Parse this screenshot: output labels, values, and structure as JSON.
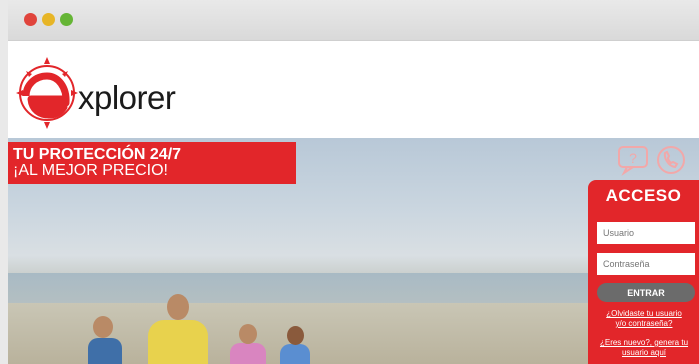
{
  "brand": {
    "logo_text": "xplorer",
    "accent": "#e2262a"
  },
  "window": {
    "controls": [
      "close",
      "minimize",
      "maximize"
    ]
  },
  "banner": {
    "line1": "TU PROTECCIÓN 24/7",
    "line2": "¡AL MEJOR PRECIO!"
  },
  "contact_icons": [
    "chat-icon",
    "phone-icon"
  ],
  "login": {
    "title": "ACCESO",
    "user_placeholder": "Usuario",
    "password_placeholder": "Contraseña",
    "submit_label": "ENTRAR",
    "forgot_line1": "¿Olvidaste tu usuario",
    "forgot_line2": "y/o contraseña?",
    "new_line1": "¿Eres nuevo?, genera tu",
    "new_line2": "usuario aquí"
  }
}
